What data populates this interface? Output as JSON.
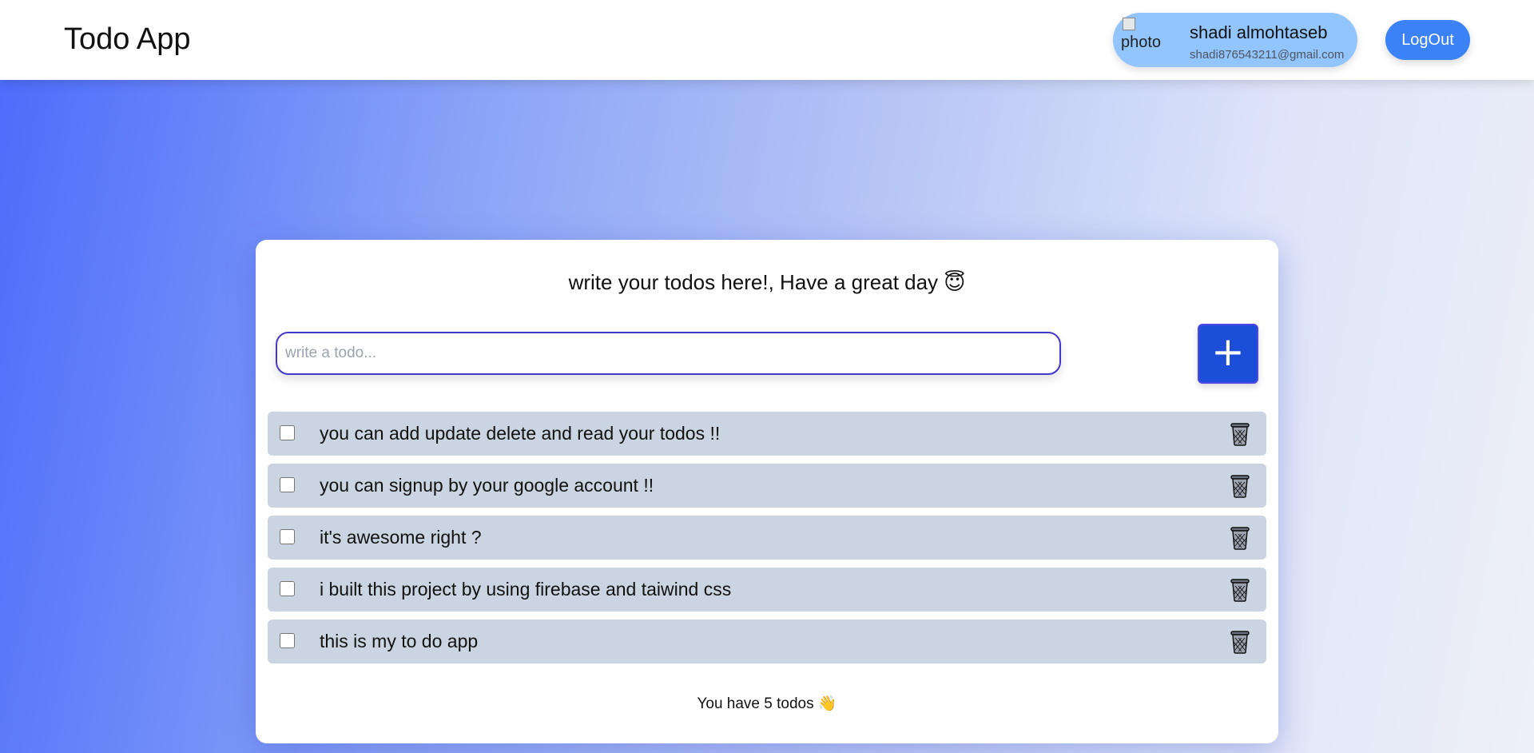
{
  "header": {
    "title": "Todo App",
    "user": {
      "avatar_alt": "photo",
      "name": "shadi almohtaseb",
      "email": "shadi876543211@gmail.com"
    },
    "logout_label": "LogOut"
  },
  "card": {
    "heading": "write your todos here!, Have a great day 😇",
    "input_placeholder": "write a todo...",
    "add_label": "+",
    "todos": [
      {
        "text": "you can add update delete and read your todos !!",
        "done": false
      },
      {
        "text": "you can signup by your google account !!",
        "done": false
      },
      {
        "text": "it's awesome right ?",
        "done": false
      },
      {
        "text": "i built this project by using firebase and taiwind css",
        "done": false
      },
      {
        "text": "this is my to do app",
        "done": false
      }
    ],
    "footer": "You have 5 todos 👋"
  },
  "colors": {
    "add_button": "#1d4ed8",
    "logout_button": "#3b82f6",
    "user_pill": "#93c5fd",
    "todo_row": "#cbd5e1"
  },
  "icons": [
    "plus-icon",
    "trash-icon",
    "broken-image-icon"
  ]
}
